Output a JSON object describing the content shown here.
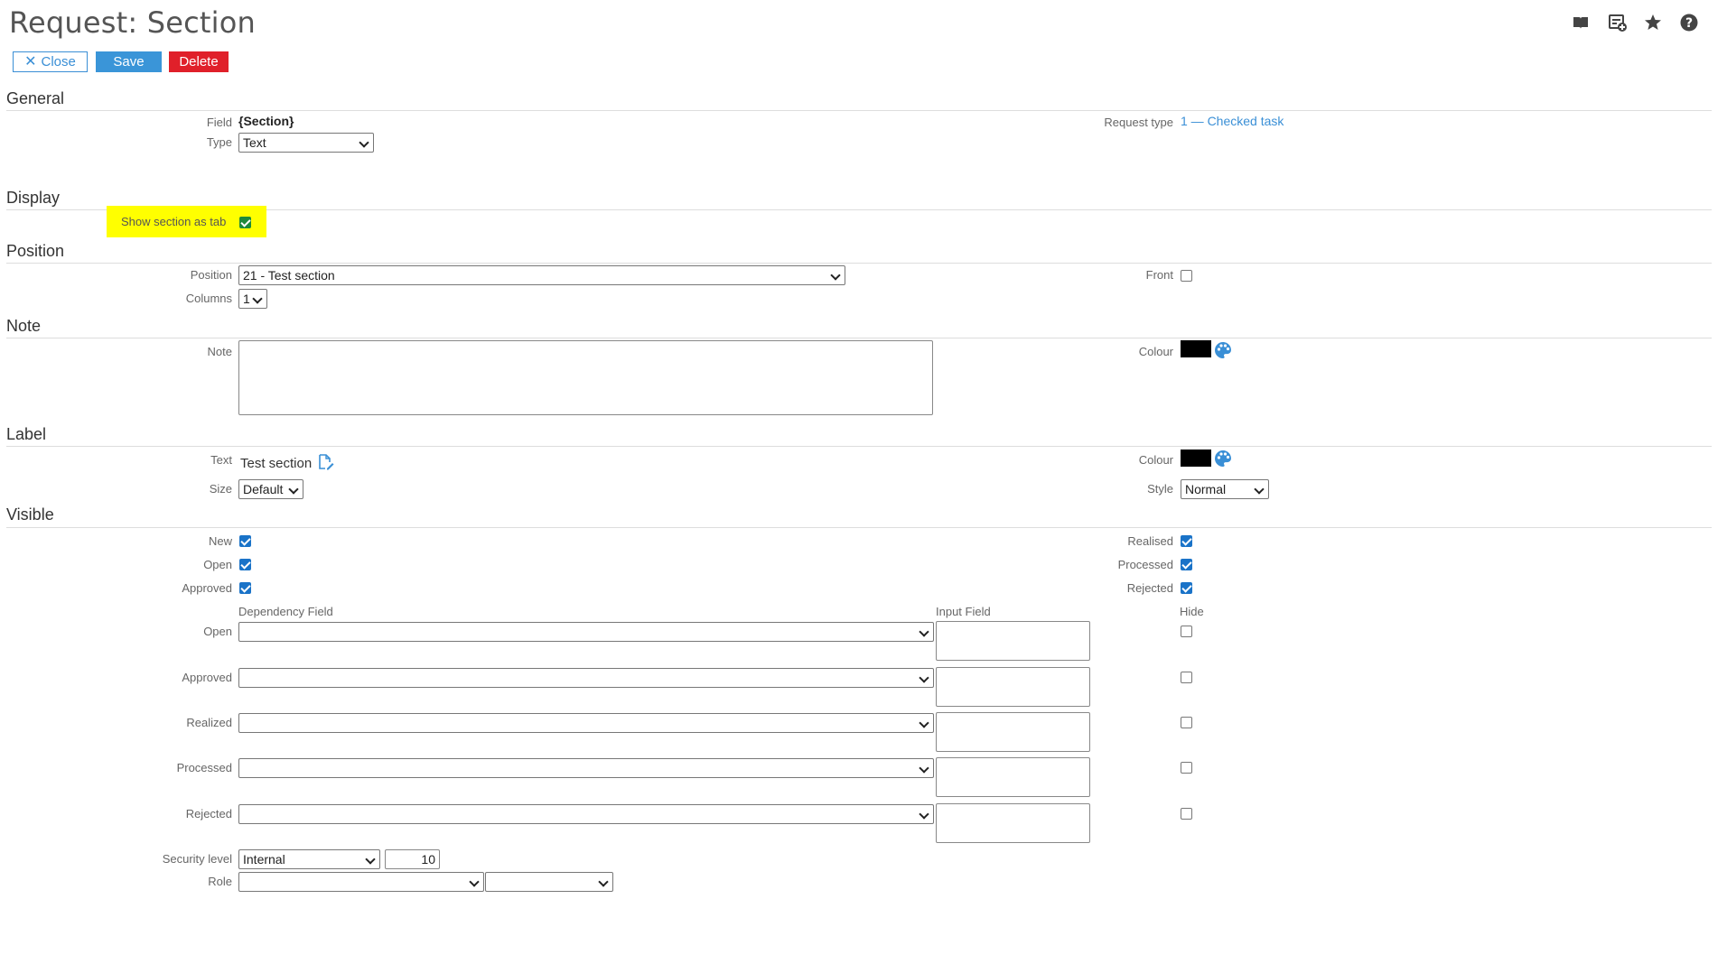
{
  "page": {
    "title": "Request: Section"
  },
  "toolbar": {
    "close_label": "Close",
    "save_label": "Save",
    "delete_label": "Delete"
  },
  "general": {
    "heading": "General",
    "field_label": "Field",
    "field_value": "{Section}",
    "type_label": "Type",
    "type_value": "Text",
    "request_type_label": "Request type",
    "request_type_value": "1 — Checked task"
  },
  "display": {
    "heading": "Display",
    "show_tab_label": "Show section as tab",
    "show_tab_checked": true
  },
  "position": {
    "heading": "Position",
    "position_label": "Position",
    "position_value": "21 - Test section",
    "columns_label": "Columns",
    "columns_value": "1",
    "front_label": "Front",
    "front_checked": false
  },
  "note": {
    "heading": "Note",
    "note_label": "Note",
    "note_value": "",
    "colour_label": "Colour",
    "colour_value": "#000000"
  },
  "label": {
    "heading": "Label",
    "text_label": "Text",
    "text_value": "Test section",
    "size_label": "Size",
    "size_value": "Default",
    "colour_label": "Colour",
    "colour_value": "#000000",
    "style_label": "Style",
    "style_value": "Normal"
  },
  "visible": {
    "heading": "Visible",
    "left_checks": [
      {
        "label": "New",
        "checked": true
      },
      {
        "label": "Open",
        "checked": true
      },
      {
        "label": "Approved",
        "checked": true
      }
    ],
    "right_checks": [
      {
        "label": "Realised",
        "checked": true
      },
      {
        "label": "Processed",
        "checked": true
      },
      {
        "label": "Rejected",
        "checked": true
      }
    ],
    "dependency_header": "Dependency Field",
    "input_header": "Input Field",
    "hide_header": "Hide",
    "dependencies": [
      {
        "label": "Open",
        "value": "",
        "input": "",
        "hide": false
      },
      {
        "label": "Approved",
        "value": "",
        "input": "",
        "hide": false
      },
      {
        "label": "Realized",
        "value": "",
        "input": "",
        "hide": false
      },
      {
        "label": "Processed",
        "value": "",
        "input": "",
        "hide": false
      },
      {
        "label": "Rejected",
        "value": "",
        "input": "",
        "hide": false
      }
    ],
    "security_label": "Security level",
    "security_value": "Internal",
    "security_number": "10",
    "role_label": "Role",
    "role_value": "",
    "role_value2": ""
  },
  "colors": {
    "accent": "#3a8fd6",
    "danger": "#e0202a",
    "highlight": "#ffff00"
  },
  "icons": [
    "book-icon",
    "add-list-icon",
    "star-icon",
    "help-icon",
    "edit-document-icon",
    "palette-icon",
    "close-icon"
  ]
}
